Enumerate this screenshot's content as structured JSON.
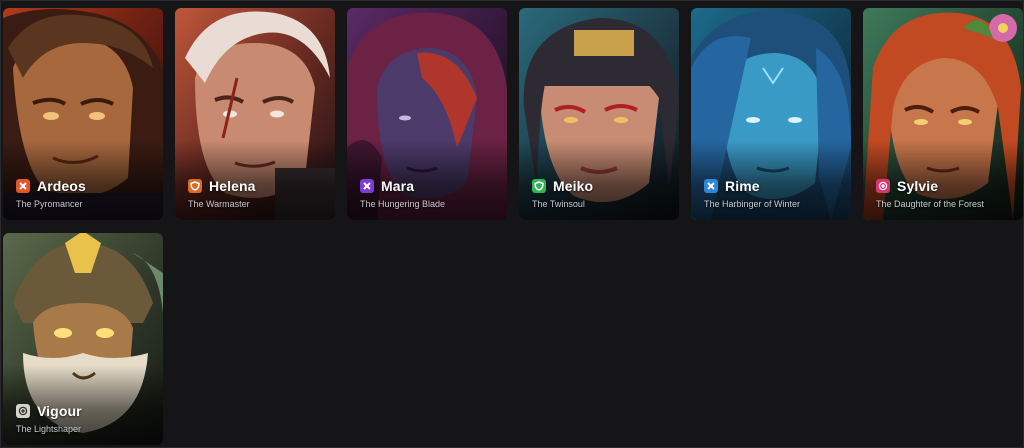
{
  "heroes": [
    {
      "name": "Ardeos",
      "title": "The Pyromancer",
      "role_icon": "cross-icon",
      "role_color": "#e2552b"
    },
    {
      "name": "Helena",
      "title": "The Warmaster",
      "role_icon": "shield-icon",
      "role_color": "#d86a22"
    },
    {
      "name": "Mara",
      "title": "The Hungering Blade",
      "role_icon": "cross-icon",
      "role_color": "#7c3ad6"
    },
    {
      "name": "Meiko",
      "title": "The Twinsoul",
      "role_icon": "shield-icon",
      "role_color": "#2fb45a"
    },
    {
      "name": "Rime",
      "title": "The Harbinger of Winter",
      "role_icon": "cross-icon",
      "role_color": "#2f86d9"
    },
    {
      "name": "Sylvie",
      "title": "The Daughter of the Forest",
      "role_icon": "plus-icon",
      "role_color": "#d9356f"
    },
    {
      "name": "Vigour",
      "title": "The Lightshaper",
      "role_icon": "plus-icon",
      "role_color": "#d6d6c8"
    }
  ]
}
